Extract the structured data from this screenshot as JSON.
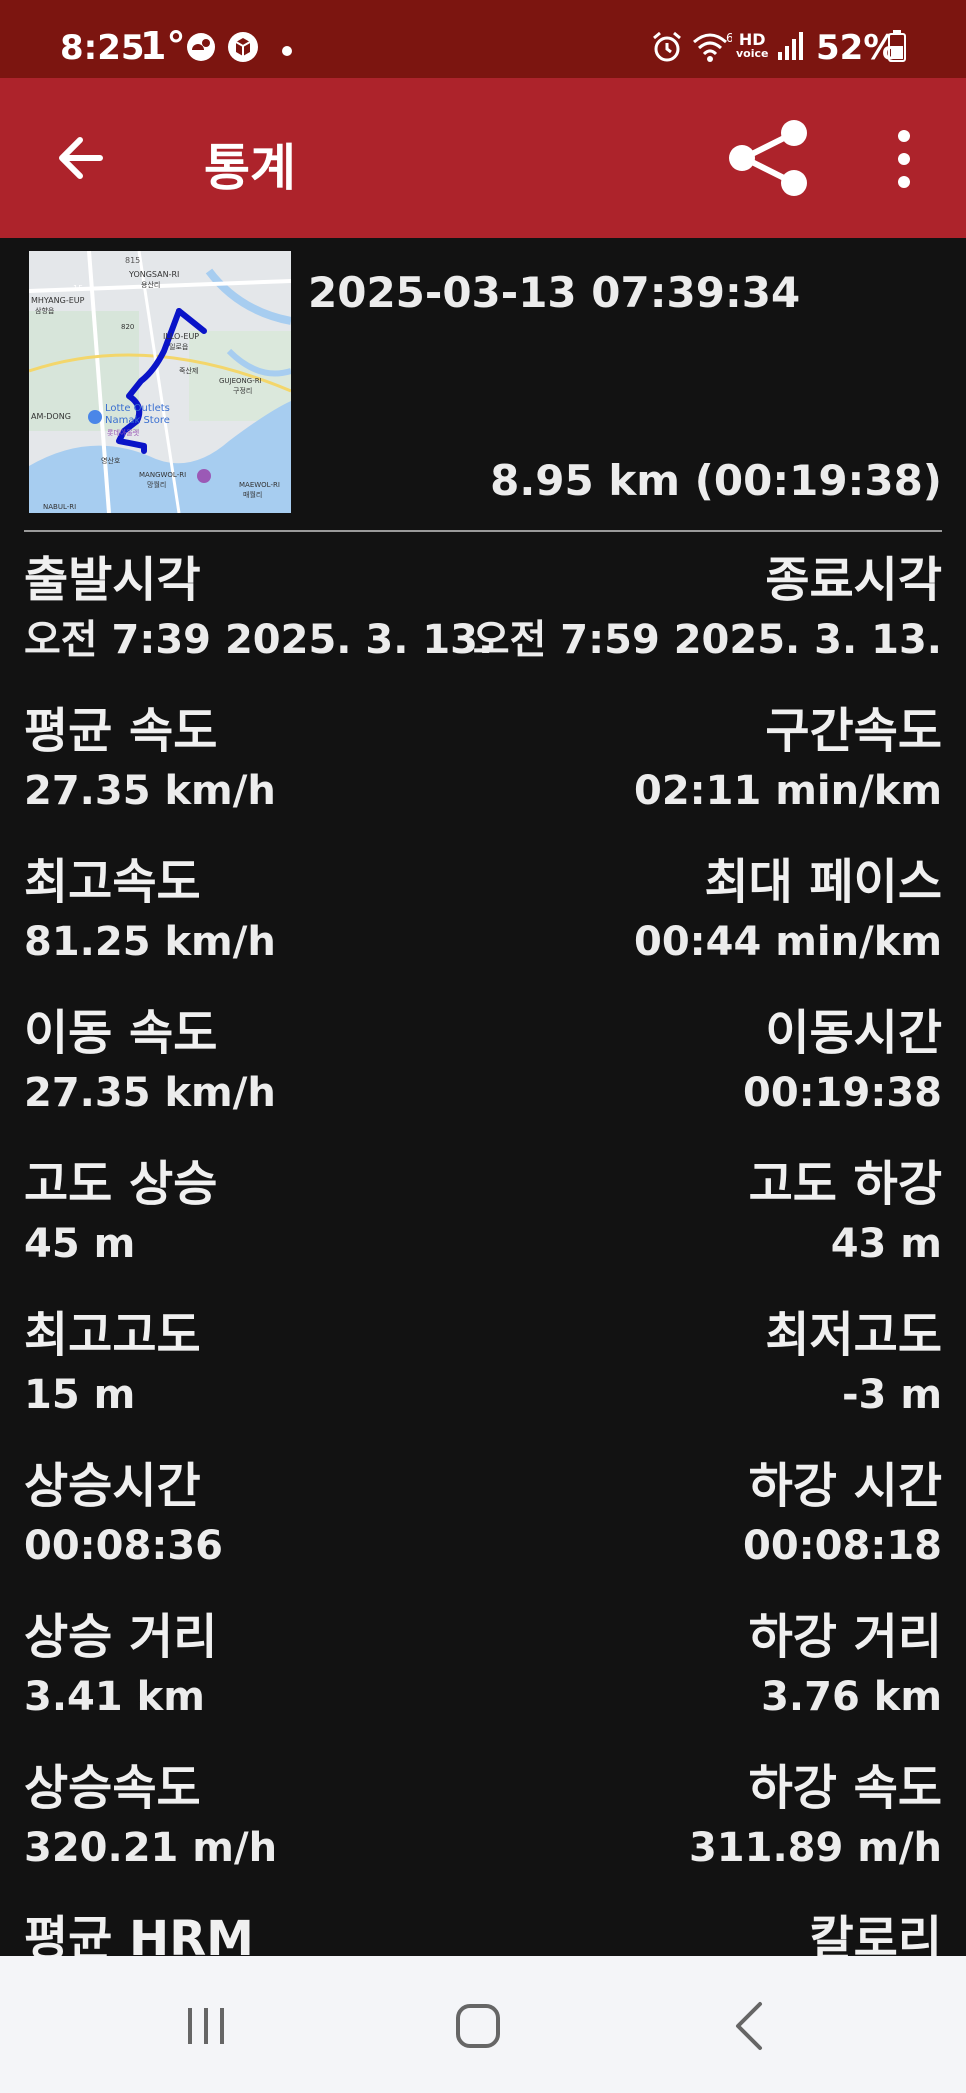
{
  "status_bar": {
    "time": "8:25",
    "temperature": "1°",
    "battery": "52%",
    "hd_voice_top": "HD",
    "hd_voice_bottom": "voice",
    "icons": [
      "weather-icon",
      "app-box-icon",
      "alarm-icon",
      "wifi-icon",
      "hd-voice-icon",
      "signal-icon",
      "battery-icon"
    ]
  },
  "app_bar": {
    "title": "통계",
    "icons": [
      "back-arrow-icon",
      "share-icon",
      "more-vertical-icon"
    ]
  },
  "summary": {
    "start_datetime": "2025-03-13 07:39:34",
    "distance_duration": "8.95 km (00:19:38)",
    "map_labels": [
      "815",
      "YONGSAN-RI",
      "용산리",
      "15",
      "MHYANG-EUP",
      "삼향읍",
      "820",
      "ILLO-EUP",
      "일로읍",
      "죽산제",
      "GUJEONG-RI",
      "구정리",
      "Lotte Outlets",
      "Namak Store",
      "AM-DONG",
      "MANGWOL-RI",
      "망월리",
      "MAEWOL-RI",
      "매월리",
      "NABUL-RI",
      "롯데아울렛",
      "영산호"
    ]
  },
  "stats": [
    {
      "left_label": "출발시각",
      "left_value": "오전 7:39 2025. 3. 13.",
      "right_label": "종료시각",
      "right_value": "오전 7:59 2025. 3. 13."
    },
    {
      "left_label": "평균 속도",
      "left_value": "27.35 km/h",
      "right_label": "구간속도",
      "right_value": "02:11 min/km"
    },
    {
      "left_label": "최고속도",
      "left_value": "81.25 km/h",
      "right_label": "최대 페이스",
      "right_value": "00:44 min/km"
    },
    {
      "left_label": "이동 속도",
      "left_value": "27.35 km/h",
      "right_label": "이동시간",
      "right_value": "00:19:38"
    },
    {
      "left_label": "고도 상승",
      "left_value": "45 m",
      "right_label": "고도 하강",
      "right_value": "43 m"
    },
    {
      "left_label": "최고고도",
      "left_value": "15 m",
      "right_label": "최저고도",
      "right_value": "-3 m"
    },
    {
      "left_label": "상승시간",
      "left_value": "00:08:36",
      "right_label": "하강 시간",
      "right_value": "00:08:18"
    },
    {
      "left_label": "상승 거리",
      "left_value": "3.41 km",
      "right_label": "하강 거리",
      "right_value": "3.76 km"
    },
    {
      "left_label": "상승속도",
      "left_value": "320.21 m/h",
      "right_label": "하강 속도",
      "right_value": "311.89 m/h"
    },
    {
      "left_label": "평균 HRM",
      "left_value": "",
      "right_label": "칼로리",
      "right_value": ""
    }
  ],
  "nav_bar": {
    "icons": [
      "recent-apps-icon",
      "home-icon",
      "back-icon"
    ]
  },
  "colors": {
    "status_bar": "#7c1510",
    "app_bar": "#ad232b",
    "background": "#121212",
    "text": "#ececec",
    "route": "#0a14c8"
  }
}
